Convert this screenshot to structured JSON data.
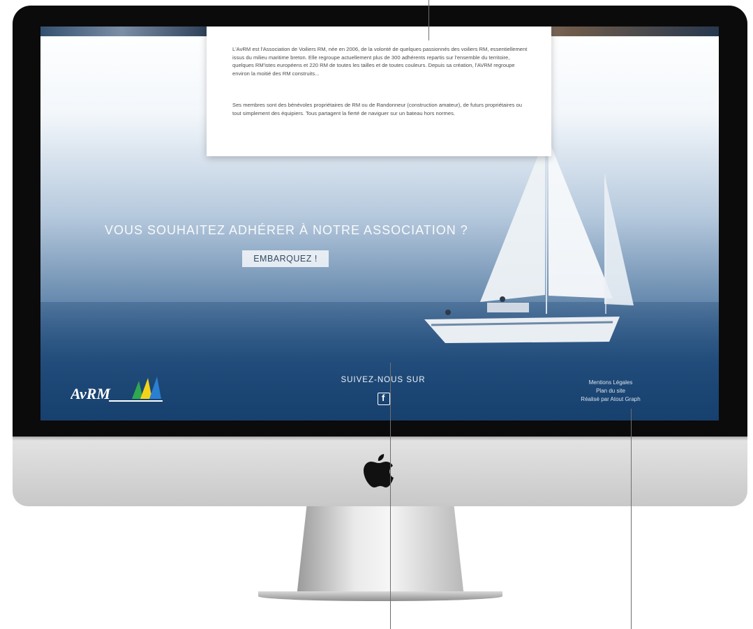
{
  "card": {
    "paragraph1": "L'AvRM est l'Association de Voiliers RM, née en 2006, de la volonté de quelques passionnés des voiliers RM, essentiellement issus du milieu maritime breton. Elle regroupe actuellement plus de 300 adhérents repartis sur l'ensemble du territoire, quelques RM'istes européens et 220 RM de toutes les tailles et de toutes couleurs. Depuis sa création, l'AVRM regroupe environ la moitié des RM construits...",
    "paragraph2": "Ses membres sont des bénévoles propriétaires de RM ou de Randonneur (construction amateur), de futurs propriétaires ou tout simplement des équipiers. Tous partagent la fierté de naviguer sur un bateau hors normes."
  },
  "cta": {
    "title": "VOUS SOUHAITEZ ADHÉRER À NOTRE ASSOCIATION ?",
    "button": "EMBARQUEZ !"
  },
  "logo": {
    "text": "AvRM"
  },
  "footer": {
    "follow": "SUIVEZ-NOUS SUR",
    "facebook_icon": "facebook-icon",
    "legal_links": [
      "Mentions Légales",
      "Plan du site",
      "Réalisé par Atout Graph"
    ]
  },
  "colors": {
    "sea": "#1f4d80",
    "sky_top": "#ffffff",
    "logo_sails": [
      "#2fa84f",
      "#f3d21b",
      "#2b7fd0"
    ]
  }
}
